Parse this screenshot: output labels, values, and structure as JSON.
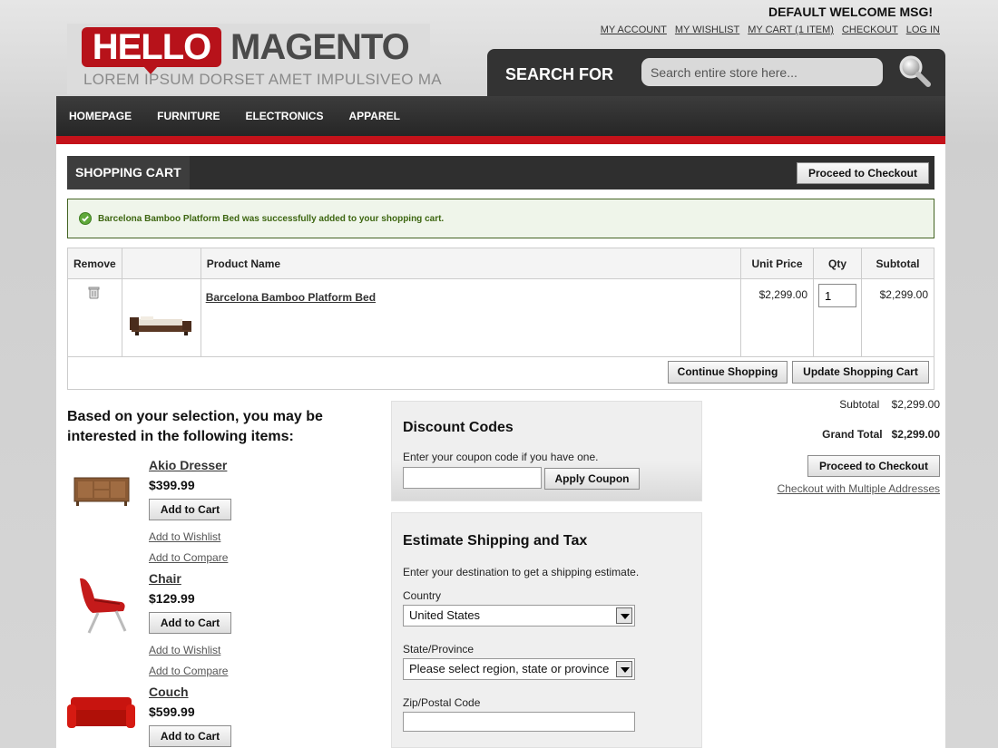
{
  "header": {
    "welcome": "DEFAULT WELCOME MSG!",
    "links": [
      "MY ACCOUNT",
      "MY WISHLIST",
      "MY CART (1 ITEM)",
      "CHECKOUT",
      "LOG IN"
    ],
    "logo_hello": "HELLO",
    "logo_magento": "MAGENTO",
    "logo_tagline": "LOREM IPSUM DORSET AMET IMPULSIVEO MA",
    "search_label": "SEARCH FOR",
    "search_placeholder": "Search entire store here..."
  },
  "nav": [
    "HOMEPAGE",
    "FURNITURE",
    "ELECTRONICS",
    "APPAREL"
  ],
  "cart": {
    "title": "SHOPPING CART",
    "checkout_label": "Proceed to Checkout",
    "success_message": "Barcelona Bamboo Platform Bed was successfully added to your shopping cart.",
    "columns": {
      "remove": "Remove",
      "name": "Product Name",
      "unit_price": "Unit Price",
      "qty": "Qty",
      "subtotal": "Subtotal"
    },
    "item": {
      "name": "Barcelona Bamboo Platform Bed",
      "unit_price": "$2,299.00",
      "qty": "1",
      "subtotal": "$2,299.00"
    },
    "continue_label": "Continue Shopping",
    "update_label": "Update Shopping Cart"
  },
  "crosssell": {
    "title": "Based on your selection, you may be interested in the following items:",
    "add_to_cart": "Add to Cart",
    "add_to_wishlist": "Add to Wishlist",
    "add_to_compare": "Add to Compare",
    "items": [
      {
        "name": "Akio Dresser",
        "price": "$399.99"
      },
      {
        "name": "Chair",
        "price": "$129.99"
      },
      {
        "name": "Couch",
        "price": "$599.99"
      }
    ]
  },
  "discount": {
    "title": "Discount Codes",
    "help": "Enter your coupon code if you have one.",
    "apply_label": "Apply Coupon"
  },
  "shipping": {
    "title": "Estimate Shipping and Tax",
    "help": "Enter your destination to get a shipping estimate.",
    "country_label": "Country",
    "country_value": "United States",
    "state_label": "State/Province",
    "state_value": "Please select region, state or province",
    "zip_label": "Zip/Postal Code"
  },
  "totals": {
    "subtotal_label": "Subtotal",
    "subtotal_value": "$2,299.00",
    "grand_label": "Grand Total",
    "grand_value": "$2,299.00",
    "checkout_label": "Proceed to Checkout",
    "multi_label": "Checkout with Multiple Addresses"
  },
  "colors": {
    "brand_red": "#c4121a",
    "nav_dark": "#2f2f2f",
    "success_green": "#3d6611"
  }
}
